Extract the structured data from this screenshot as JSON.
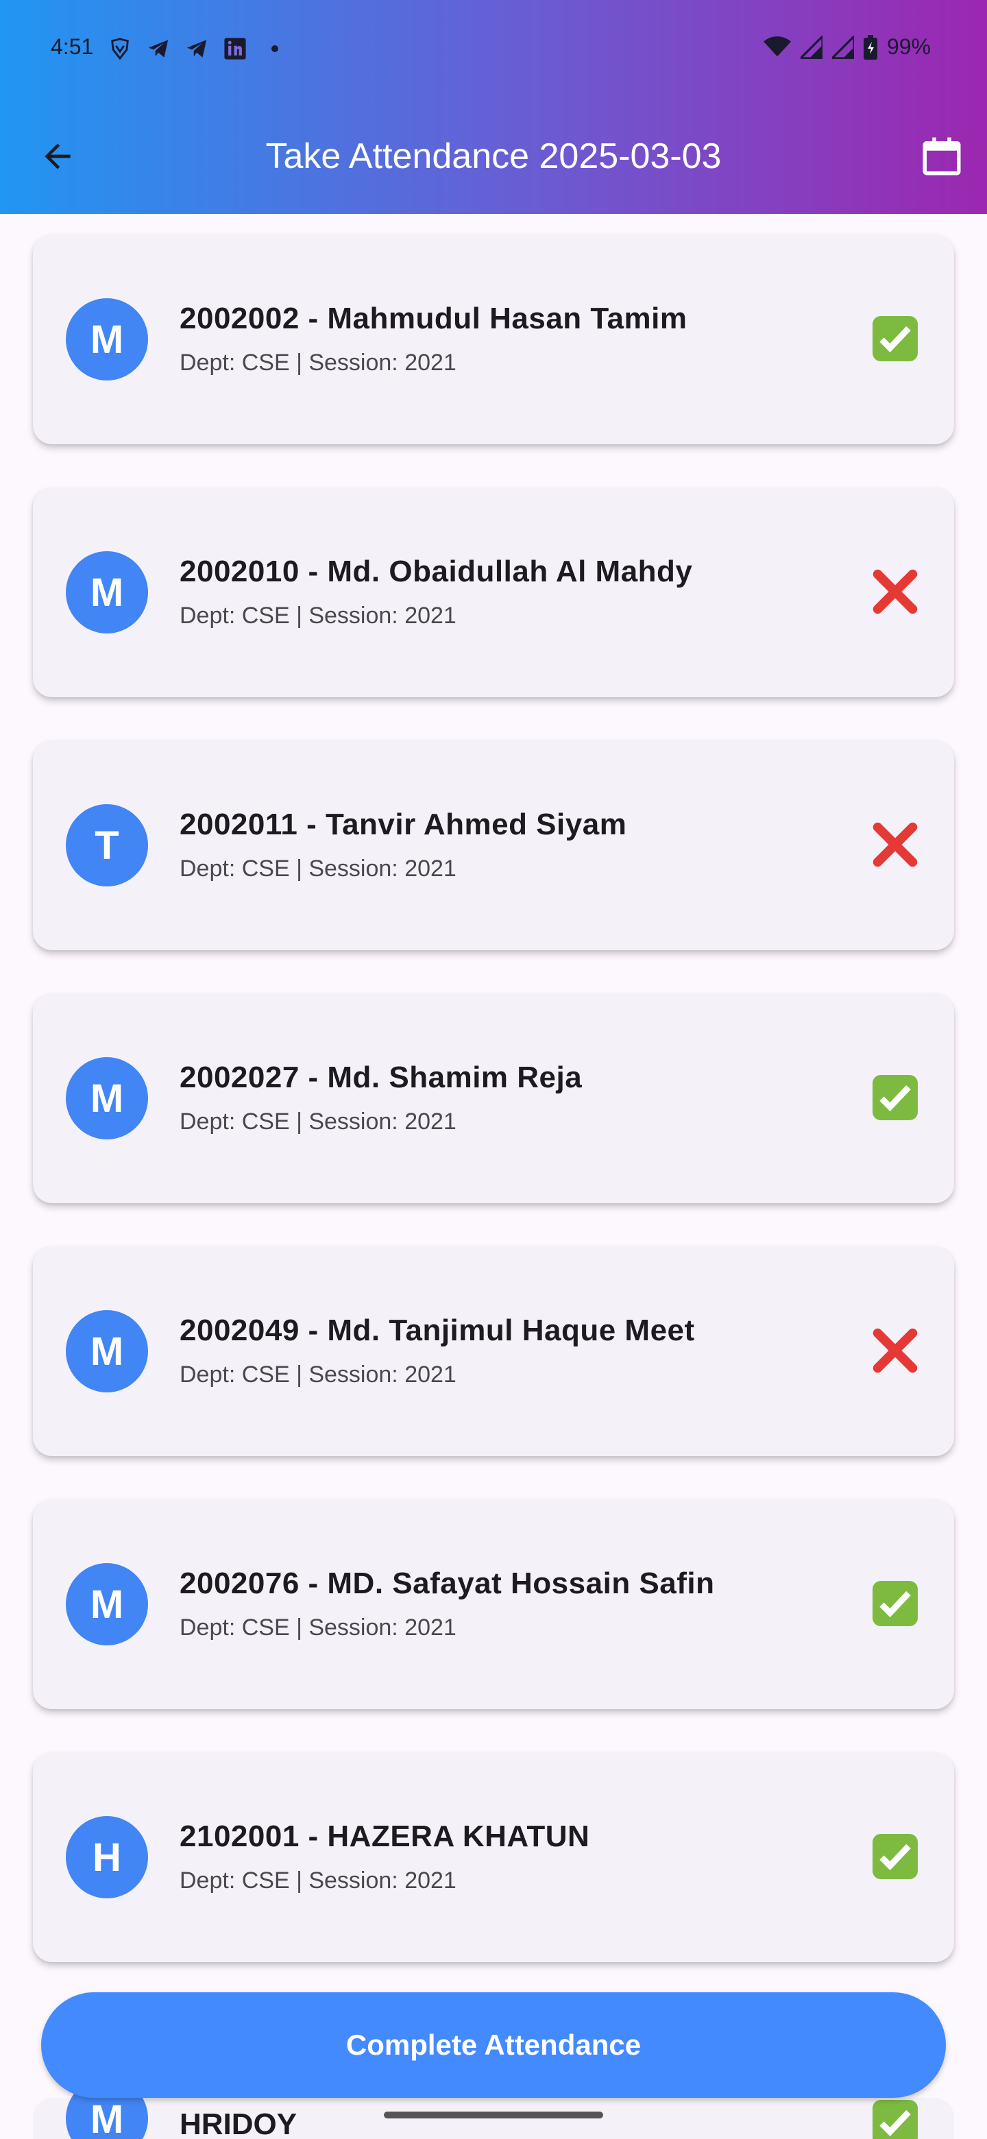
{
  "status_bar": {
    "time": "4:51",
    "battery": "99%",
    "left_icons": [
      "brave-icon",
      "telegram-icon",
      "telegram-icon",
      "linkedin-icon"
    ],
    "right_icons": [
      "wifi-icon",
      "signal-icon",
      "signal-icon",
      "battery-icon"
    ]
  },
  "header": {
    "title": "Take Attendance 2025-03-03",
    "back_icon": "arrow-left-icon",
    "calendar_icon": "calendar-icon",
    "gradient": [
      "#2196f3",
      "#9c27b0"
    ]
  },
  "students": [
    {
      "initial": "M",
      "title": "2002002 - Mahmudul Hasan Tamim",
      "subtitle": "Dept: CSE | Session: 2021",
      "present": true
    },
    {
      "initial": "M",
      "title": "2002010 - Md. Obaidullah Al Mahdy",
      "subtitle": "Dept: CSE | Session: 2021",
      "present": false
    },
    {
      "initial": "T",
      "title": "2002011 - Tanvir Ahmed Siyam",
      "subtitle": "Dept: CSE | Session: 2021",
      "present": false
    },
    {
      "initial": "M",
      "title": "2002027 - Md. Shamim Reja",
      "subtitle": "Dept: CSE | Session: 2021",
      "present": true
    },
    {
      "initial": "M",
      "title": "2002049 - Md. Tanjimul Haque Meet",
      "subtitle": "Dept: CSE | Session: 2021",
      "present": false
    },
    {
      "initial": "M",
      "title": "2002076 - MD. Safayat Hossain Safin",
      "subtitle": "Dept: CSE | Session: 2021",
      "present": true
    },
    {
      "initial": "H",
      "title": "2102001 - HAZERA KHATUN",
      "subtitle": "Dept: CSE | Session: 2021",
      "present": true
    }
  ],
  "partial_student": {
    "initial": "M",
    "title": "HRIDOY",
    "present": true
  },
  "complete_button": "Complete Attendance",
  "colors": {
    "avatar": "#4285f4",
    "button": "#448aff",
    "present": "#7cbb3f",
    "absent": "#e53935"
  }
}
